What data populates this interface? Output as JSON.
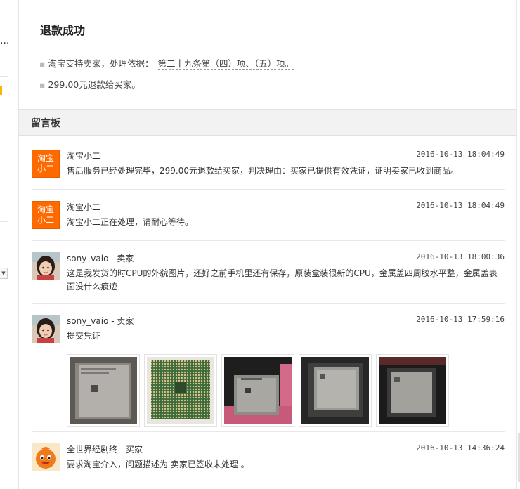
{
  "refund": {
    "title": "退款成功",
    "line1_prefix": "淘宝支持卖家，处理依据：",
    "line1_law": "第二十九条第（四）项、（五）项。",
    "line2": "299.00元退款给买家。"
  },
  "board": {
    "title": "留言板",
    "messages": [
      {
        "avatar_text": [
          "淘宝",
          "小二"
        ],
        "name": "淘宝小二",
        "time": "2016-10-13 18:04:49",
        "text": "售后服务已经处理完毕，299.00元退款给买家，判决理由：买家已提供有效凭证，证明卖家已收到商品。"
      },
      {
        "avatar_text": [
          "淘宝",
          "小二"
        ],
        "name": "淘宝小二",
        "time": "2016-10-13 18:04:49",
        "text": "淘宝小二正在处理，请耐心等待。"
      },
      {
        "name": "sony_vaio - 卖家",
        "time": "2016-10-13 18:00:36",
        "text": "这是我发货的时CPU的外貌图片，还好之前手机里还有保存，原装盒装很新的CPU，金属盖四周胶水平整，金属盖表面没什么痕迹"
      },
      {
        "name": "sony_vaio - 卖家",
        "time": "2016-10-13 17:59:16",
        "text": "提交凭证"
      },
      {
        "name": "全世界经剧终 - 买家",
        "time": "2016-10-13 14:36:24",
        "text": "要求淘宝介入，问题描述为 卖家已签收未处理 。"
      }
    ]
  },
  "left_fragment": {
    "dots": "..."
  },
  "colors": {
    "taobao_orange": "#ff6a00",
    "header_bg": "#f2f2f2"
  },
  "icons": {
    "dropdown": "chevron-down-icon",
    "avatars": [
      "taobao-xiaoer-avatar",
      "seller-child-photo-avatar",
      "buyer-cartoon-avatar"
    ]
  }
}
